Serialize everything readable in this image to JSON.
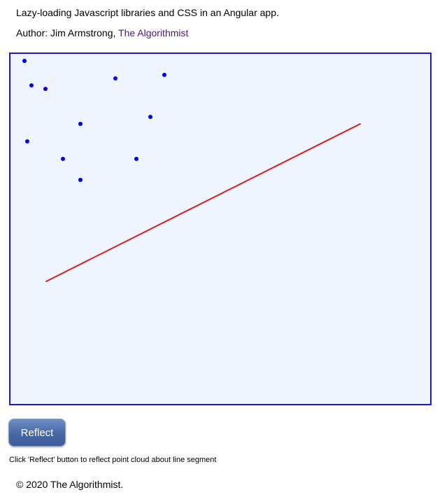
{
  "header": {
    "title": "Lazy-loading Javascript libraries and CSS in an Angular app.",
    "author_prefix": "Author: Jim Armstrong, ",
    "author_link": "The Algorithmist"
  },
  "colors": {
    "canvas_bg": "#eef5ff",
    "canvas_border": "#1a1ad6",
    "point": "#0000e0",
    "segment": "#e01a1a",
    "link": "#4b1a7a",
    "button": "#4867a4"
  },
  "actions": {
    "reflect_label": "Reflect",
    "hint": "Click 'Reflect' button to reflect point cloud about line segment"
  },
  "footer": {
    "copyright": "© 2020 The Algorithmist."
  }
}
